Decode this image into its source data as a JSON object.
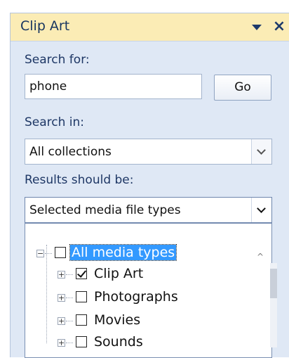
{
  "pane": {
    "title": "Clip Art",
    "close_glyph": "×"
  },
  "search": {
    "label": "Search for:",
    "value": "phone",
    "go_label": "Go"
  },
  "search_in": {
    "label": "Search in:",
    "selected": "All collections"
  },
  "results": {
    "label": "Results should be:",
    "selected": "Selected media file types"
  },
  "media_tree": {
    "root": {
      "label": "All media types",
      "checked": false,
      "selected": true
    },
    "children": [
      {
        "label": "Clip Art",
        "checked": true
      },
      {
        "label": "Photographs",
        "checked": false
      },
      {
        "label": "Movies",
        "checked": false
      },
      {
        "label": "Sounds",
        "checked": false
      }
    ]
  },
  "icons": {
    "expander_collapse": "minus-box-icon",
    "expander_expand": "plus-box-icon",
    "menu": "triangle-down-icon",
    "close": "close-icon",
    "dropdown": "chevron-down-icon"
  },
  "colors": {
    "title_bar": "#fbecb5",
    "pane_background": "#dfe8f5",
    "selection": "#3399ff"
  }
}
